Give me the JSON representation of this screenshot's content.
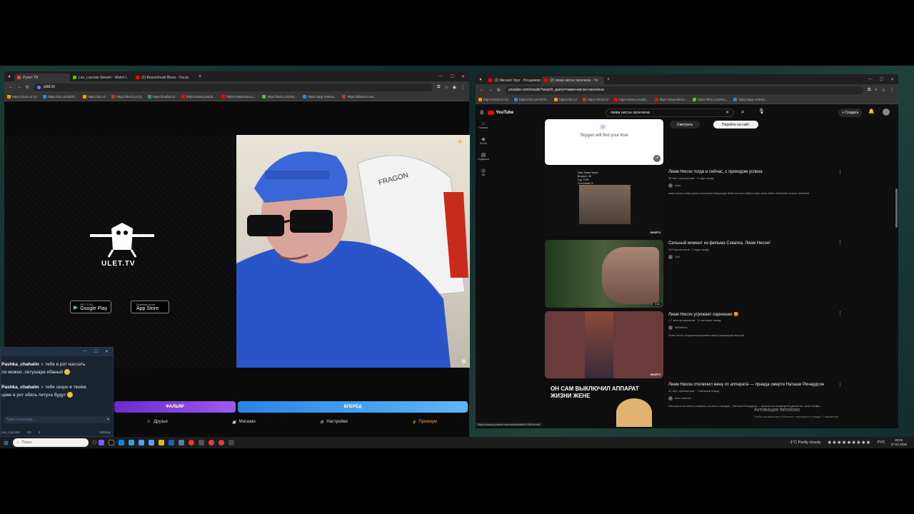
{
  "left_browser": {
    "tabs": [
      {
        "label": "Рулет ТВ",
        "color": "#e74c3c"
      },
      {
        "label": "Leo_Lacoste Stream - Watch L",
        "color": "#53c22b"
      },
      {
        "label": "(2) Bossonhusil Blues - Oscar",
        "color": "#ff0000"
      }
    ],
    "url": "ulet.tv",
    "bookmarks": [
      "https://mail.ru/ (1)",
      "https://vk.com/id70...",
      "https://ok.ru/",
      "https://lenili.ru/ (1)",
      "https://lostbit.ru/",
      "https://www.youtub...",
      "https://www.ltsmu.c...",
      "https://kick.com/leo...",
      "https://app.restrea...",
      "https://distrroo.mst..."
    ]
  },
  "ulet": {
    "logo": "ULET.TV",
    "google_play": {
      "small": "GET IT ON",
      "big": "Google Play"
    },
    "app_store": {
      "small": "Download on the",
      "big": "App Store"
    },
    "btn_left": "ФАЛЬЯР",
    "btn_right": "ВПЕРЁД",
    "nav": [
      {
        "label": "Друзья",
        "icon": "friends-icon"
      },
      {
        "label": "Магазин",
        "icon": "shop-icon"
      },
      {
        "label": "Настройки",
        "icon": "gear-icon"
      },
      {
        "label": "Премиум",
        "icon": "crown-icon"
      }
    ]
  },
  "chat": {
    "messages": [
      {
        "user": "Pashka_chahalin",
        "text": "тебе в рот нассать",
        "text2": "ло можно ,петушара ебаный"
      },
      {
        "user": "Pashka_chahalin",
        "text": "тебя скоро в твоём",
        "text2": "цеве в рот ебать петуха будут"
      }
    ],
    "input_placeholder": "Type a message...",
    "footer_channel": "Leo_Lacoste",
    "footer_count1": "1/1",
    "footer_count2": "5",
    "footer_settings": "Settings"
  },
  "right_browser": {
    "tabs": [
      {
        "label": "(2) Михаил Круг - Владимир",
        "color": "#ff0000"
      },
      {
        "label": "(2) лиам нисон окончена - Yo",
        "color": "#ff0000"
      }
    ],
    "url": "youtube.com/results?search_query=лиам+нисон+окончена",
    "bookmarks": [
      "https://mail.ru/ (1)",
      "https://vk.com/id70...",
      "https://ok.ru/",
      "https://lenili.ru/",
      "https://www.youtub...",
      "https://www.ltsmu...",
      "https://kick.com/leo...",
      "https://app.restrea..."
    ],
    "search_text": "лиам нисон окончена",
    "create_label": "+ Создать",
    "ad": {
      "brand": "Skygen will find your love",
      "btn_watch": "Смотреть",
      "btn_go": "Перейти на сайт"
    },
    "sidebar": [
      "Главная",
      "Shorts",
      "Подписки",
      "Вы"
    ],
    "videos": [
      {
        "title": "Лиам Нисон тогда и сейчас, с приходом успеха.",
        "meta": "36 тыс. просмотров · 2 года назад",
        "channel": "Nora",
        "desc": "лиам #нисон #Шиндлер #типичный #миграция #Вин #meson #taken #star #now #then #Schindler #oskar #seinfeld",
        "badge": "SHORTS",
        "thumb_overlay": "Имя: Лиам Нисон\nВозраст: 36\nГод: 1978\nСостояние: 8"
      },
      {
        "title": "Сильный момент из фильма Схватка. Лиам Нисон!",
        "meta": "415 просмотров · 2 года назад",
        "channel": "Gull",
        "desc": "",
        "badge": "0:34",
        "thumb_overlay": ""
      },
      {
        "title": "Лиам Нисон угрожает парнишке 😡",
        "meta": "1,7 млн просмотров · 11 месяцев назад",
        "channel": "MrBarthus",
        "desc": "Лиам Нисон продемонстрировал свой угрожающий настрой.",
        "badge": "SHORTS",
        "thumb_overlay": ""
      },
      {
        "title": "Лиам Нисон отключил жену от аппарата — правда смерти Наташи Ричардсон",
        "meta": "41 тыс. просмотров · 7 месяцев назад",
        "channel": "Мои новости",
        "desc": "Она упала на снегу и сказала, что всё в порядке... Наташа Ричардсон — актриса из знаменитой династии, жена Лиама...",
        "badge": "",
        "thumb_overlay": "ОН САМ ВЫКЛЮЧИЛ АППАРАТ ЖИЗНИ ЖЕНЕ"
      }
    ],
    "status_url": "https://www.youtube.com/shorts/6bmVY6WVmzk",
    "activation_title": "Активация Windows",
    "activation_text": "Чтобы активировать Windows, перейдите в раздел \"Параметры\"."
  },
  "taskbar": {
    "search_placeholder": "Поиск",
    "weather": "-1°C  Partly cloudy",
    "lang": "РУС",
    "time": "20:02",
    "date": "07.01.2026"
  }
}
